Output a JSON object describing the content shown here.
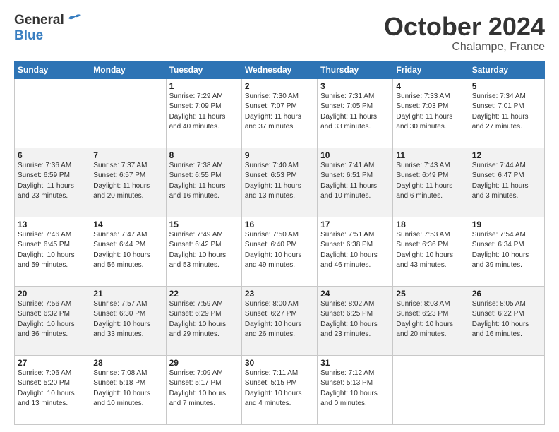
{
  "header": {
    "logo": {
      "line1": "General",
      "line2": "Blue"
    },
    "title": "October 2024",
    "location": "Chalampe, France"
  },
  "weekdays": [
    "Sunday",
    "Monday",
    "Tuesday",
    "Wednesday",
    "Thursday",
    "Friday",
    "Saturday"
  ],
  "weeks": [
    [
      {
        "day": "",
        "detail": ""
      },
      {
        "day": "",
        "detail": ""
      },
      {
        "day": "1",
        "detail": "Sunrise: 7:29 AM\nSunset: 7:09 PM\nDaylight: 11 hours\nand 40 minutes."
      },
      {
        "day": "2",
        "detail": "Sunrise: 7:30 AM\nSunset: 7:07 PM\nDaylight: 11 hours\nand 37 minutes."
      },
      {
        "day": "3",
        "detail": "Sunrise: 7:31 AM\nSunset: 7:05 PM\nDaylight: 11 hours\nand 33 minutes."
      },
      {
        "day": "4",
        "detail": "Sunrise: 7:33 AM\nSunset: 7:03 PM\nDaylight: 11 hours\nand 30 minutes."
      },
      {
        "day": "5",
        "detail": "Sunrise: 7:34 AM\nSunset: 7:01 PM\nDaylight: 11 hours\nand 27 minutes."
      }
    ],
    [
      {
        "day": "6",
        "detail": "Sunrise: 7:36 AM\nSunset: 6:59 PM\nDaylight: 11 hours\nand 23 minutes."
      },
      {
        "day": "7",
        "detail": "Sunrise: 7:37 AM\nSunset: 6:57 PM\nDaylight: 11 hours\nand 20 minutes."
      },
      {
        "day": "8",
        "detail": "Sunrise: 7:38 AM\nSunset: 6:55 PM\nDaylight: 11 hours\nand 16 minutes."
      },
      {
        "day": "9",
        "detail": "Sunrise: 7:40 AM\nSunset: 6:53 PM\nDaylight: 11 hours\nand 13 minutes."
      },
      {
        "day": "10",
        "detail": "Sunrise: 7:41 AM\nSunset: 6:51 PM\nDaylight: 11 hours\nand 10 minutes."
      },
      {
        "day": "11",
        "detail": "Sunrise: 7:43 AM\nSunset: 6:49 PM\nDaylight: 11 hours\nand 6 minutes."
      },
      {
        "day": "12",
        "detail": "Sunrise: 7:44 AM\nSunset: 6:47 PM\nDaylight: 11 hours\nand 3 minutes."
      }
    ],
    [
      {
        "day": "13",
        "detail": "Sunrise: 7:46 AM\nSunset: 6:45 PM\nDaylight: 10 hours\nand 59 minutes."
      },
      {
        "day": "14",
        "detail": "Sunrise: 7:47 AM\nSunset: 6:44 PM\nDaylight: 10 hours\nand 56 minutes."
      },
      {
        "day": "15",
        "detail": "Sunrise: 7:49 AM\nSunset: 6:42 PM\nDaylight: 10 hours\nand 53 minutes."
      },
      {
        "day": "16",
        "detail": "Sunrise: 7:50 AM\nSunset: 6:40 PM\nDaylight: 10 hours\nand 49 minutes."
      },
      {
        "day": "17",
        "detail": "Sunrise: 7:51 AM\nSunset: 6:38 PM\nDaylight: 10 hours\nand 46 minutes."
      },
      {
        "day": "18",
        "detail": "Sunrise: 7:53 AM\nSunset: 6:36 PM\nDaylight: 10 hours\nand 43 minutes."
      },
      {
        "day": "19",
        "detail": "Sunrise: 7:54 AM\nSunset: 6:34 PM\nDaylight: 10 hours\nand 39 minutes."
      }
    ],
    [
      {
        "day": "20",
        "detail": "Sunrise: 7:56 AM\nSunset: 6:32 PM\nDaylight: 10 hours\nand 36 minutes."
      },
      {
        "day": "21",
        "detail": "Sunrise: 7:57 AM\nSunset: 6:30 PM\nDaylight: 10 hours\nand 33 minutes."
      },
      {
        "day": "22",
        "detail": "Sunrise: 7:59 AM\nSunset: 6:29 PM\nDaylight: 10 hours\nand 29 minutes."
      },
      {
        "day": "23",
        "detail": "Sunrise: 8:00 AM\nSunset: 6:27 PM\nDaylight: 10 hours\nand 26 minutes."
      },
      {
        "day": "24",
        "detail": "Sunrise: 8:02 AM\nSunset: 6:25 PM\nDaylight: 10 hours\nand 23 minutes."
      },
      {
        "day": "25",
        "detail": "Sunrise: 8:03 AM\nSunset: 6:23 PM\nDaylight: 10 hours\nand 20 minutes."
      },
      {
        "day": "26",
        "detail": "Sunrise: 8:05 AM\nSunset: 6:22 PM\nDaylight: 10 hours\nand 16 minutes."
      }
    ],
    [
      {
        "day": "27",
        "detail": "Sunrise: 7:06 AM\nSunset: 5:20 PM\nDaylight: 10 hours\nand 13 minutes."
      },
      {
        "day": "28",
        "detail": "Sunrise: 7:08 AM\nSunset: 5:18 PM\nDaylight: 10 hours\nand 10 minutes."
      },
      {
        "day": "29",
        "detail": "Sunrise: 7:09 AM\nSunset: 5:17 PM\nDaylight: 10 hours\nand 7 minutes."
      },
      {
        "day": "30",
        "detail": "Sunrise: 7:11 AM\nSunset: 5:15 PM\nDaylight: 10 hours\nand 4 minutes."
      },
      {
        "day": "31",
        "detail": "Sunrise: 7:12 AM\nSunset: 5:13 PM\nDaylight: 10 hours\nand 0 minutes."
      },
      {
        "day": "",
        "detail": ""
      },
      {
        "day": "",
        "detail": ""
      }
    ]
  ]
}
